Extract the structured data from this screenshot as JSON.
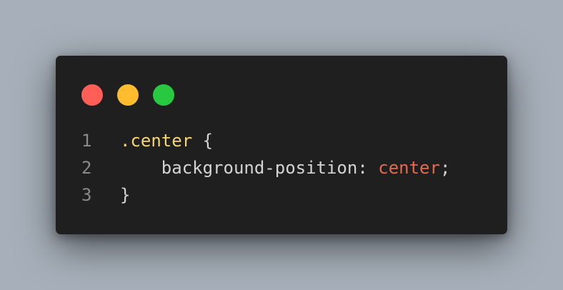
{
  "window": {
    "traffic_lights": [
      {
        "name": "close",
        "color": "#ff5f57"
      },
      {
        "name": "minimize",
        "color": "#febc2e"
      },
      {
        "name": "maximize",
        "color": "#28c840"
      }
    ]
  },
  "code": {
    "lines": [
      {
        "number": "1",
        "selector": ".center",
        "open_brace": " {"
      },
      {
        "number": "2",
        "indent": "    ",
        "property": "background-position",
        "colon": ": ",
        "value": "center",
        "semicolon": ";"
      },
      {
        "number": "3",
        "close_brace": "}"
      }
    ]
  },
  "colors": {
    "background": "#a7b0ba",
    "window": "#1f1f1f",
    "selector": "#f5d76e",
    "value": "#e8684a",
    "text": "#d4d4d4",
    "line_number": "#8a8a8a"
  }
}
